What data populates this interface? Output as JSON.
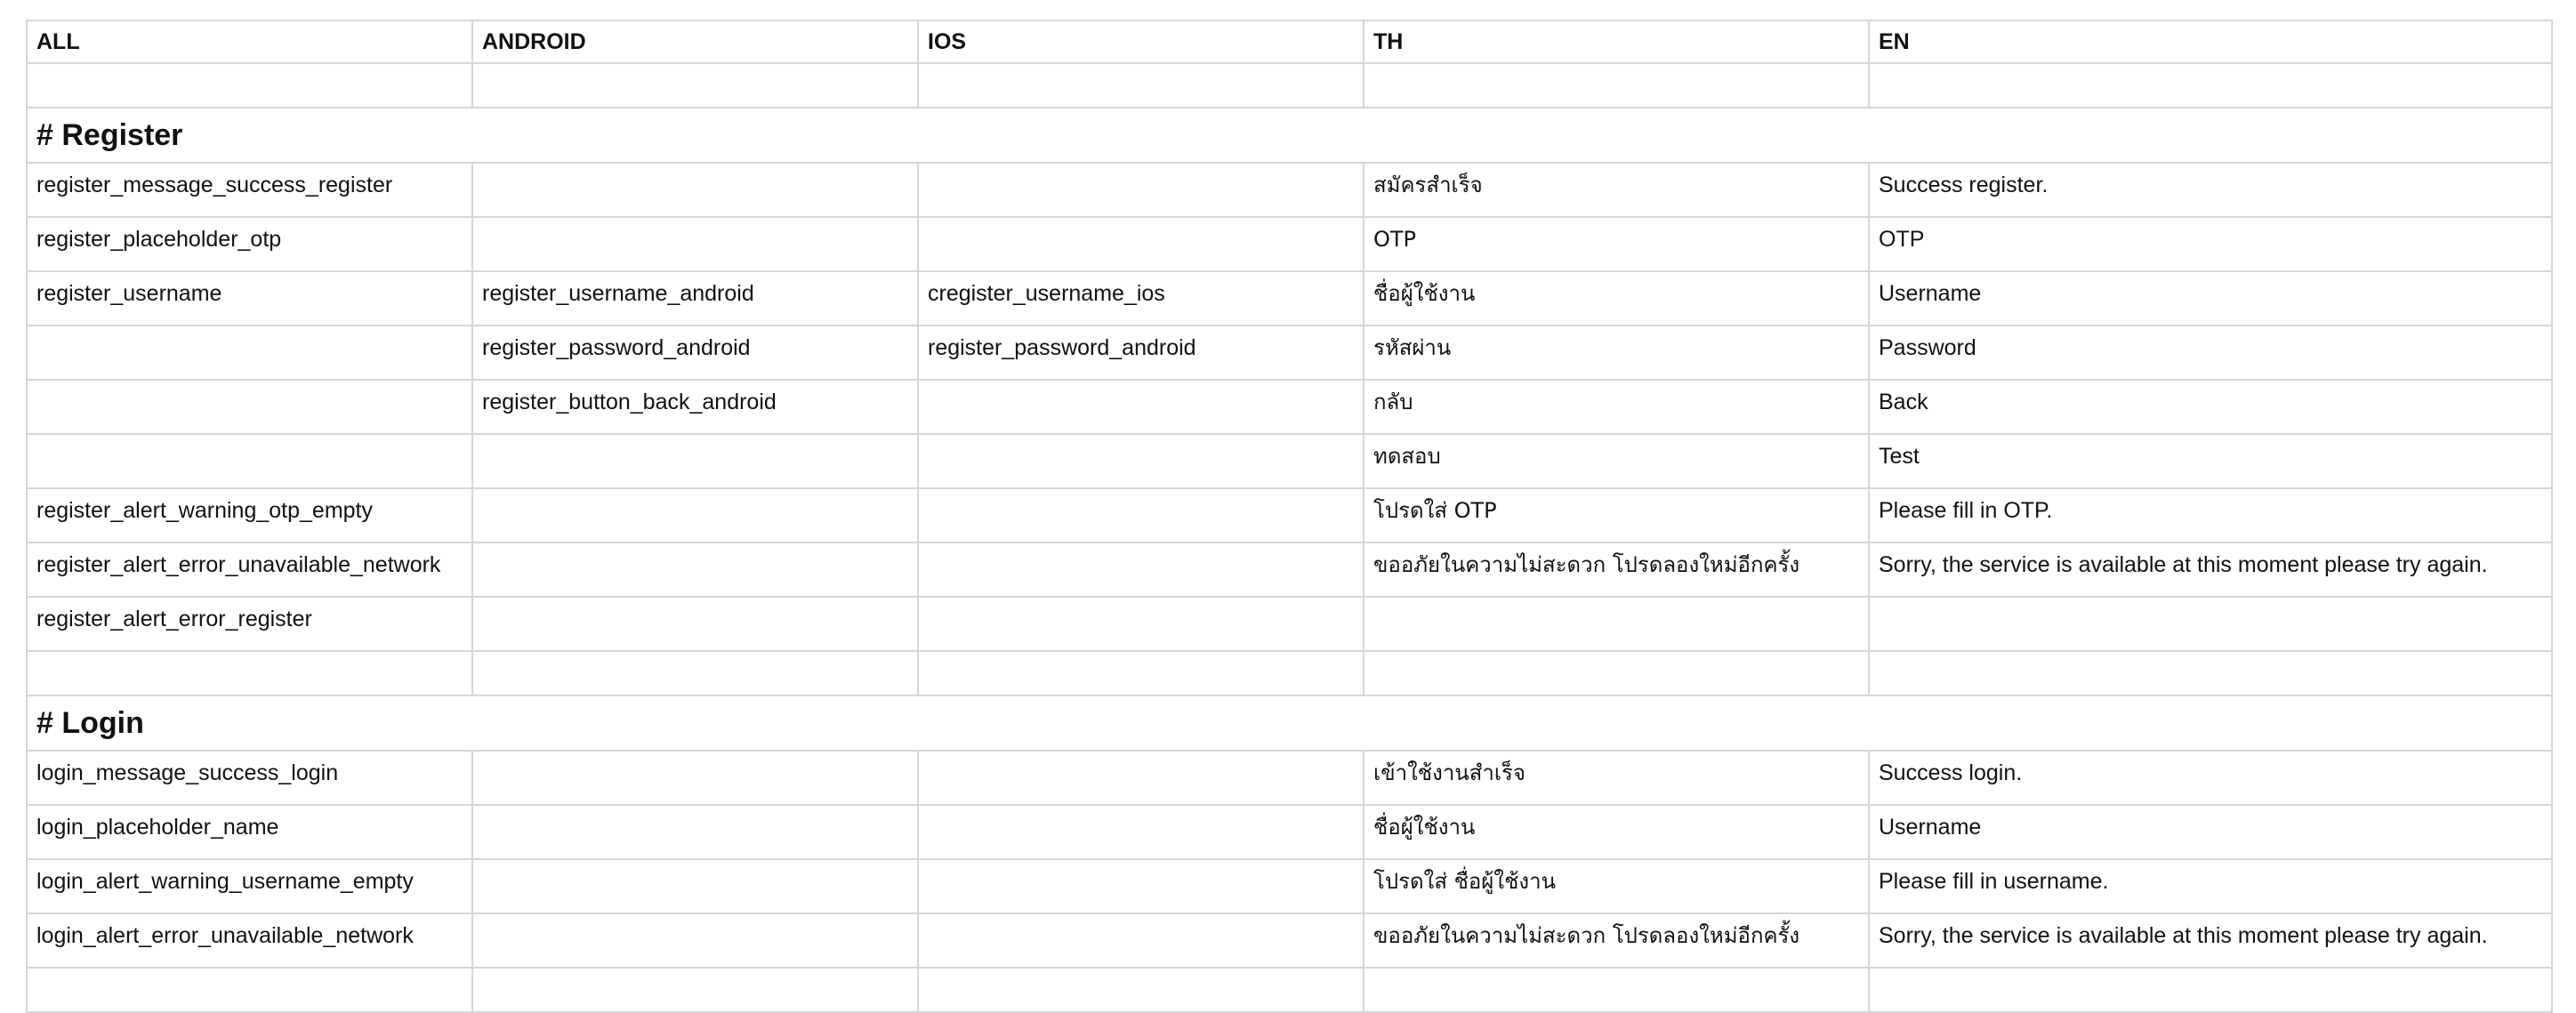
{
  "headers": [
    "ALL",
    "ANDROID",
    "IOS",
    "TH",
    "EN"
  ],
  "sections": [
    {
      "title": "# Register",
      "rows": [
        {
          "all": "register_message_success_register",
          "android": "",
          "ios": "",
          "th": "สมัครสำเร็จ",
          "en": "Success register."
        },
        {
          "all": "register_placeholder_otp",
          "android": "",
          "ios": "",
          "th": "OTP",
          "en": "OTP"
        },
        {
          "all": "register_username",
          "android": "register_username_android",
          "ios": "cregister_username_ios",
          "th": "ชื่อผู้ใช้งาน",
          "en": "Username"
        },
        {
          "all": "",
          "android": "register_password_android",
          "ios": "register_password_android",
          "th": "รหัสผ่าน",
          "en": "Password"
        },
        {
          "all": "",
          "android": "register_button_back_android",
          "ios": "",
          "th": "กลับ",
          "en": "Back"
        },
        {
          "all": "",
          "android": "",
          "ios": "",
          "th": "ทดสอบ",
          "en": "Test"
        },
        {
          "all": "register_alert_warning_otp_empty",
          "android": "",
          "ios": "",
          "th": "โปรดใส่ OTP",
          "en": "Please fill in OTP."
        },
        {
          "all": "register_alert_error_unavailable_network",
          "android": "",
          "ios": "",
          "th": "ขออภัยในความไม่สะดวก โปรดลองใหม่อีกครั้ง",
          "en": "Sorry, the service is available at this moment please try again."
        },
        {
          "all": "register_alert_error_register",
          "android": "",
          "ios": "",
          "th": "",
          "en": ""
        }
      ]
    },
    {
      "title": "# Login",
      "rows": [
        {
          "all": "login_message_success_login",
          "android": "",
          "ios": "",
          "th": "เข้าใช้งานสำเร็จ",
          "en": "Success login."
        },
        {
          "all": "login_placeholder_name",
          "android": "",
          "ios": "",
          "th": "ชื่อผู้ใช้งาน",
          "en": "Username"
        },
        {
          "all": "login_alert_warning_username_empty",
          "android": "",
          "ios": "",
          "th": "โปรดใส่ ชื่อผู้ใช้งาน",
          "en": "Please fill in username."
        },
        {
          "all": "login_alert_error_unavailable_network",
          "android": "",
          "ios": "",
          "th": "ขออภัยในความไม่สะดวก โปรดลองใหม่อีกครั้ง",
          "en": "Sorry, the service is available at this moment please try again."
        }
      ]
    }
  ]
}
